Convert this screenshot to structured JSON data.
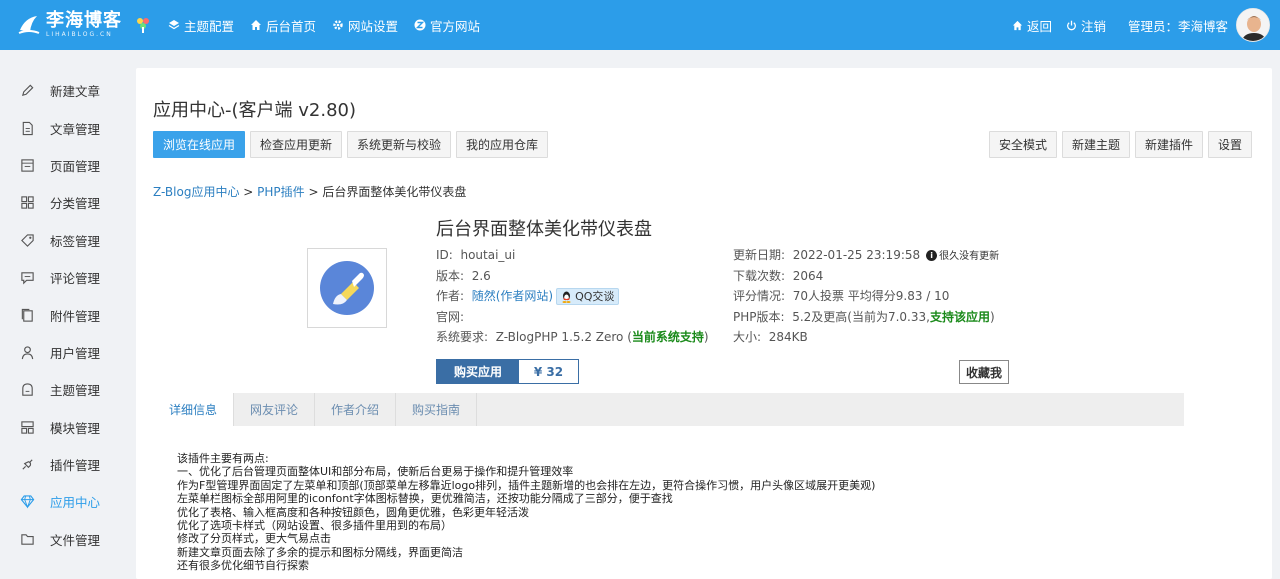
{
  "header": {
    "logo_main": "李海博客",
    "logo_sub": "LIHAIBLOG.CN",
    "nav": [
      {
        "label": "主题配置",
        "icon": "palette-icon"
      },
      {
        "label": "后台首页",
        "icon": "home-icon"
      },
      {
        "label": "网站设置",
        "icon": "gear-icon"
      },
      {
        "label": "官方网站",
        "icon": "zblog-icon"
      }
    ],
    "back_label": "返回",
    "logout_label": "注销",
    "admin_label": "管理员：李海博客"
  },
  "sidebar": {
    "items": [
      {
        "label": "新建文章",
        "icon": "pencil-icon"
      },
      {
        "label": "文章管理",
        "icon": "document-icon"
      },
      {
        "label": "页面管理",
        "icon": "page-icon"
      },
      {
        "label": "分类管理",
        "icon": "grid-icon"
      },
      {
        "label": "标签管理",
        "icon": "tag-icon"
      },
      {
        "label": "评论管理",
        "icon": "comment-icon"
      },
      {
        "label": "附件管理",
        "icon": "attachment-icon"
      },
      {
        "label": "用户管理",
        "icon": "user-icon"
      },
      {
        "label": "主题管理",
        "icon": "theme-icon"
      },
      {
        "label": "模块管理",
        "icon": "module-icon"
      },
      {
        "label": "插件管理",
        "icon": "plugin-icon"
      },
      {
        "label": "应用中心",
        "icon": "diamond-icon"
      },
      {
        "label": "文件管理",
        "icon": "folder-icon"
      }
    ],
    "active_index": 11
  },
  "main": {
    "title": "应用中心-(客户端 v2.80)",
    "buttons_left": [
      "浏览在线应用",
      "检查应用更新",
      "系统更新与校验",
      "我的应用仓库"
    ],
    "buttons_right": [
      "安全模式",
      "新建主题",
      "新建插件",
      "设置"
    ],
    "breadcrumb": {
      "root": "Z-Blog应用中心",
      "sep1": " > ",
      "category": "PHP插件",
      "sep2": " > ",
      "current": "后台界面整体美化带仪表盘"
    },
    "app": {
      "title": "后台界面整体美化带仪表盘",
      "id_label": "ID:",
      "id_value": "houtai_ui",
      "version_label": "版本:",
      "version_value": "2.6",
      "author_label": "作者:",
      "author_value": "随然(作者网站)",
      "qq_label": "QQ交谈",
      "website_label": "官网:",
      "req_label": "系统要求:",
      "req_value": "Z-BlogPHP 1.5.2 Zero (",
      "req_support": "当前系统支持",
      "req_end": ")",
      "update_label": "更新日期:",
      "update_value": "2022-01-25 23:19:58",
      "update_note": "很久没有更新",
      "downloads_label": "下载次数:",
      "downloads_value": "2064",
      "rating_label": "评分情况:",
      "rating_value": "70人投票 平均得分9.83 / 10",
      "php_label": "PHP版本:",
      "php_value": "5.2及更高(当前为7.0.33,",
      "php_support": "支持该应用",
      "php_end": ")",
      "size_label": "大小:",
      "size_value": "284KB",
      "buy_label": "购买应用",
      "price": "¥ 32",
      "fav_label": "收藏我"
    },
    "tabs": [
      "详细信息",
      "网友评论",
      "作者介绍",
      "购买指南"
    ],
    "active_tab": 0,
    "description": [
      "该插件主要有两点:",
      "一、优化了后台管理页面整体UI和部分布局，使新后台更易于操作和提升管理效率",
      "作为F型管理界面固定了左菜单和顶部(顶部菜单左移靠近logo排列，插件主题新增的也会排在左边，更符合操作习惯，用户头像区域展开更美观)",
      "左菜单栏图标全部用阿里的iconfont字体图标替换，更优雅简洁，还按功能分隔成了三部分，便于查找",
      "优化了表格、输入框高度和各种按钮颜色，圆角更优雅，色彩更年轻活泼",
      "优化了选项卡样式（网站设置、很多插件里用到的布局）",
      "修改了分页样式，更大气易点击",
      "新建文章页面去除了多余的提示和图标分隔线，界面更简洁",
      "还有很多优化细节自行探索"
    ]
  }
}
